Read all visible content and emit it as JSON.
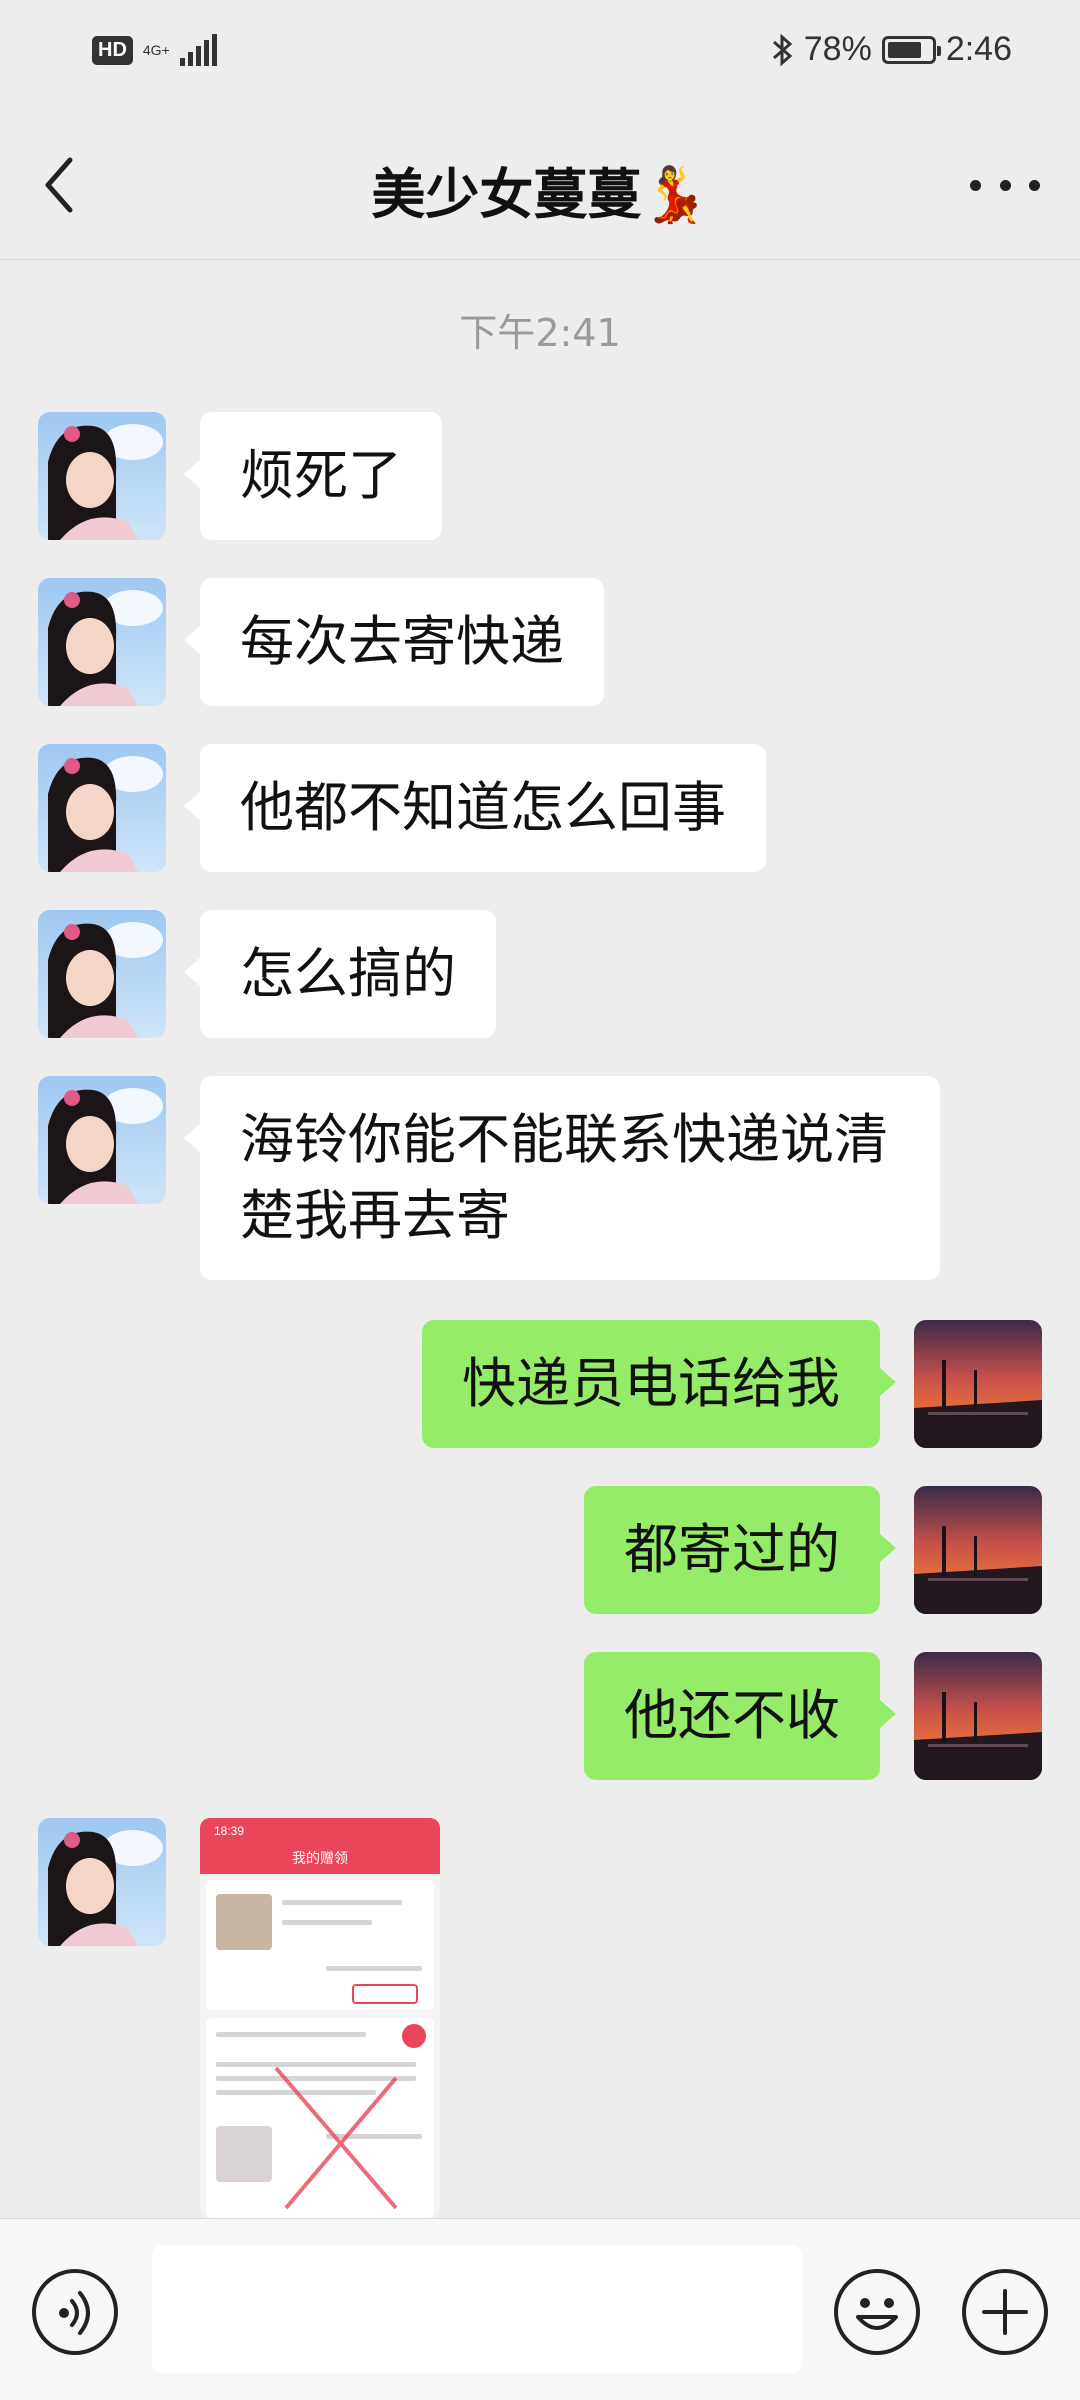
{
  "status_bar": {
    "hd_badge": "HD",
    "network": "4G+",
    "battery_percent": "78%",
    "battery_level": 0.78,
    "time": "2:46",
    "icons": [
      "hd-icon",
      "signal-icon",
      "bluetooth-icon",
      "battery-icon"
    ]
  },
  "header": {
    "title": "美少女蔓蔓💃",
    "back_icon": "chevron-left-icon",
    "more_icon": "more-dots-icon"
  },
  "timestamp": "下午2:41",
  "messages": [
    {
      "from": "contact",
      "text": "烦死了"
    },
    {
      "from": "contact",
      "text": "每次去寄快递"
    },
    {
      "from": "contact",
      "text": "他都不知道怎么回事"
    },
    {
      "from": "contact",
      "text": "怎么搞的"
    },
    {
      "from": "contact",
      "text": "海铃你能不能联系快递说清楚我再去寄"
    },
    {
      "from": "me",
      "text": "快递员电话给我"
    },
    {
      "from": "me",
      "text": "都寄过的"
    },
    {
      "from": "me",
      "text": "他还不收"
    },
    {
      "from": "contact",
      "type": "image"
    }
  ],
  "image_message": {
    "time": "18:39",
    "title": "我的赠领"
  },
  "colors": {
    "chat_background": "#ededed",
    "incoming_bubble": "#ffffff",
    "outgoing_bubble": "#95ec69",
    "screenshot_header": "#e94659"
  },
  "bottom_bar": {
    "voice_icon": "voice-icon",
    "emoji_icon": "emoji-icon",
    "plus_icon": "plus-icon",
    "input_value": ""
  }
}
